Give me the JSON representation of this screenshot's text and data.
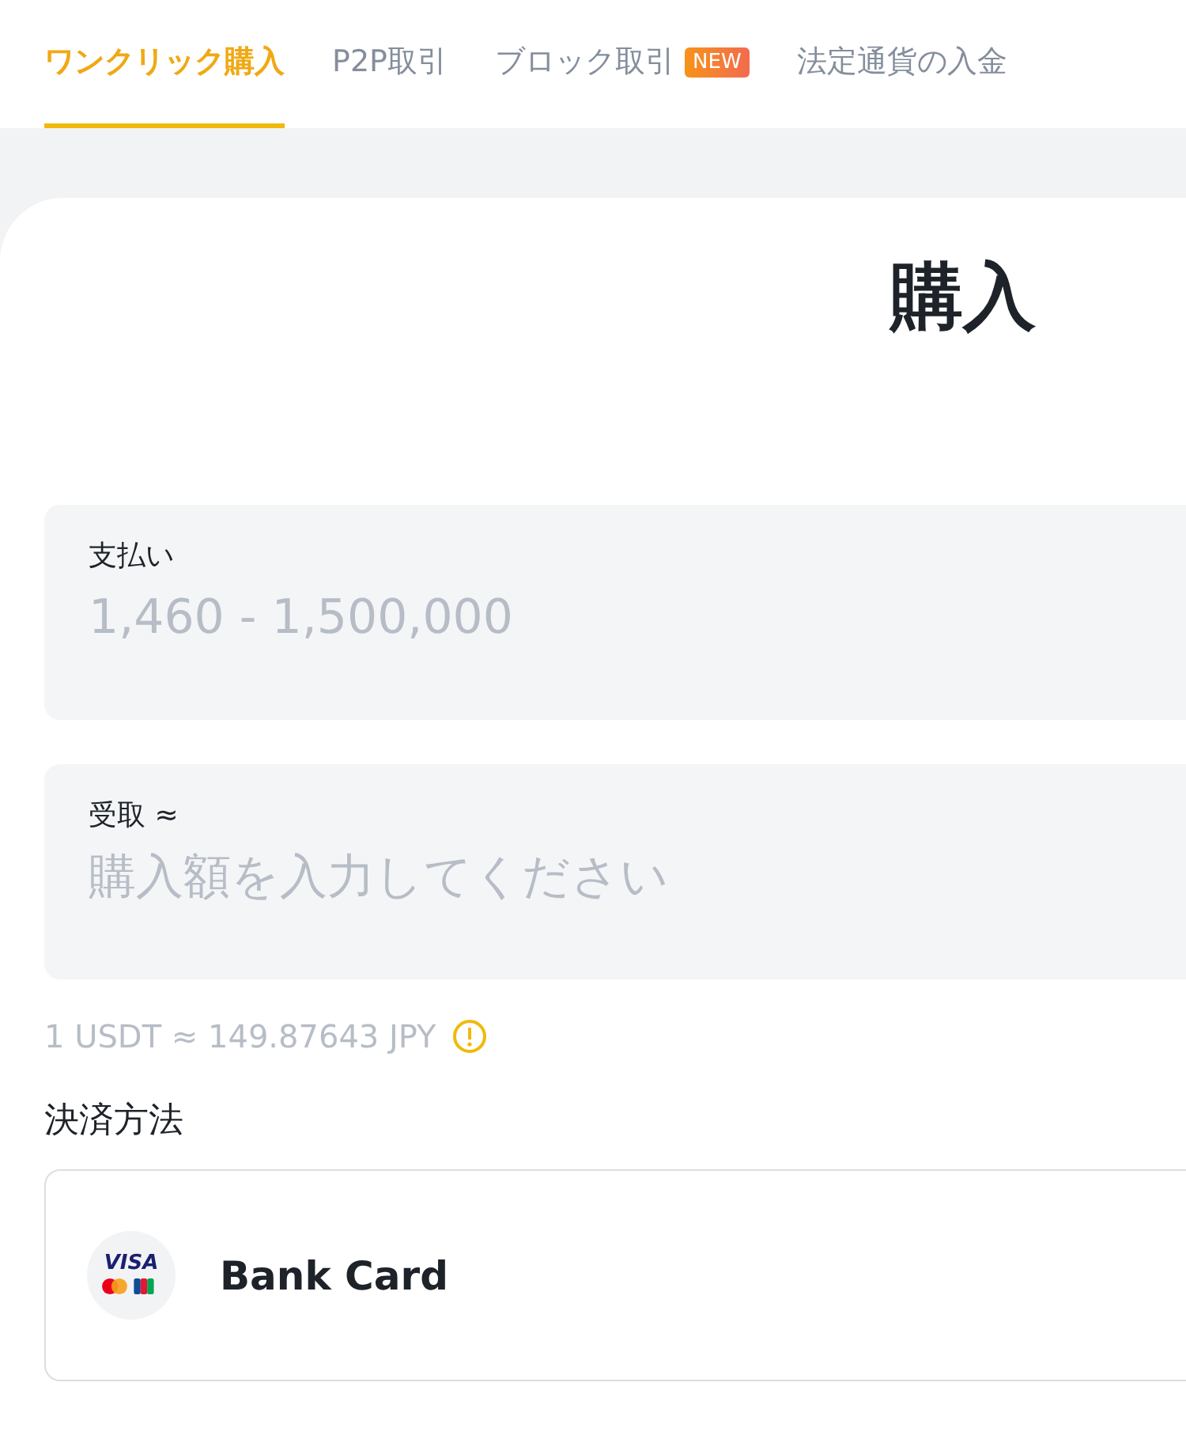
{
  "tabs": [
    {
      "label": "ワンクリック購入",
      "selected": true
    },
    {
      "label": "P2P取引",
      "selected": false
    },
    {
      "label": "ブロック取引",
      "selected": false,
      "badge": "NEW"
    },
    {
      "label": "法定通貨の入金",
      "selected": false
    }
  ],
  "title": "購入",
  "fields": [
    {
      "label": "支払い",
      "placeholder": "1,460 - 1,500,000"
    },
    {
      "label": "受取 ≈",
      "placeholder": "購入額を入力してください"
    }
  ],
  "rate": "1 USDT ≈ 149.87643 JPY",
  "payment_heading": "決済方法",
  "payment_method": {
    "logo_text": "VISA",
    "label": "Bank Card"
  }
}
